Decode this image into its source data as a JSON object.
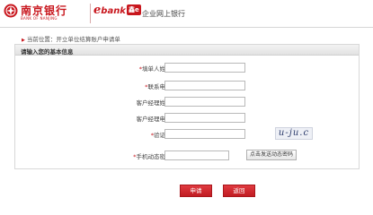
{
  "header": {
    "bank_name_cn": "南京银行",
    "bank_name_en": "BANK OF NANJING",
    "ebank_letter": "e",
    "ebank_word": "bank",
    "ebank_badge": "鑫e",
    "portal_title": "企业网上银行",
    "brand_color": "#c8161d"
  },
  "breadcrumb": {
    "text": "当前位置：开立单位结算账户申请单"
  },
  "panel": {
    "title": "请输入您的基本信息"
  },
  "form": {
    "applicant_name": {
      "label": "填单人姓名：",
      "required": true,
      "value": ""
    },
    "contact_phone": {
      "label": "联系电话：",
      "required": true,
      "value": ""
    },
    "manager_name": {
      "label": "客户经理姓名：",
      "required": false,
      "value": ""
    },
    "manager_phone": {
      "label": "客户经理电话：",
      "required": false,
      "value": ""
    },
    "captcha": {
      "label": "验证码：",
      "required": true,
      "value": "",
      "image_text": "u-ju.c"
    },
    "otp": {
      "label": "手机动态密码：",
      "required": true,
      "value": "",
      "button_label": "点击发送动态密码"
    }
  },
  "actions": {
    "apply_label": "申请",
    "return_label": "返回"
  }
}
